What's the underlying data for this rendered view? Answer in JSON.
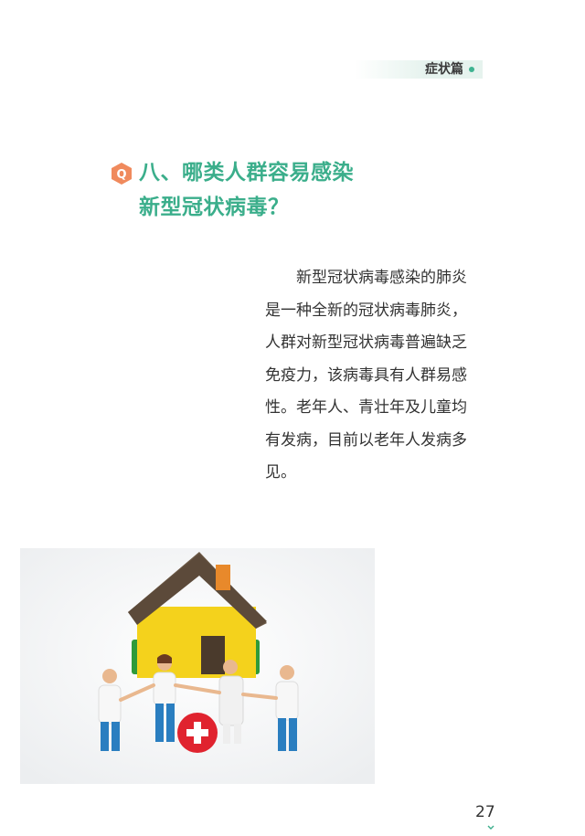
{
  "header": {
    "section_label": "症状篇"
  },
  "question": {
    "badge_letter": "Q",
    "title_lines": [
      "八、哪类人群容易感染",
      "新型冠状病毒？"
    ]
  },
  "body": {
    "lines": [
      "　　新型冠状病毒感染的肺炎",
      "是一种全新的冠状病毒肺炎，",
      "人群对新型冠状病毒普遍缺乏",
      "免疫力，该病毒具有人群易感",
      "性。老年人、青壮年及儿童均",
      "有发病，目前以老年人发病多",
      "见。"
    ]
  },
  "illustration": {
    "icon": "family-house-medical-photo"
  },
  "footer": {
    "page_number": "27"
  },
  "colors": {
    "accent_green": "#3bae8b",
    "badge_orange": "#f08a5d",
    "body_text": "#333333"
  }
}
